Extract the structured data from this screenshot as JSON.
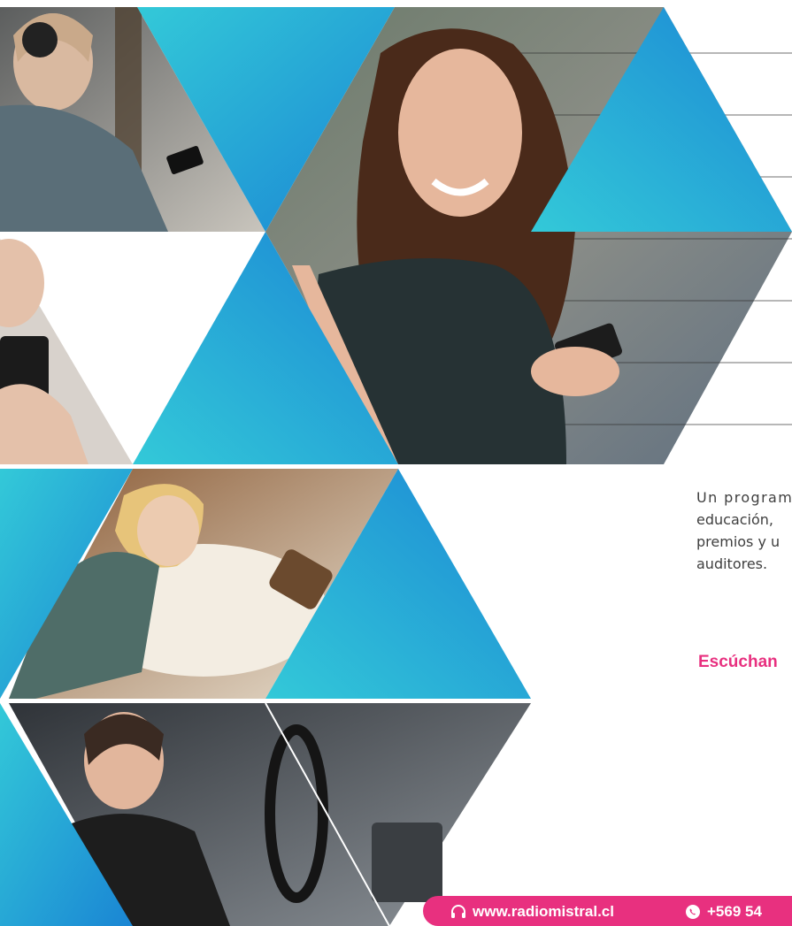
{
  "intro": {
    "line1": "Un program",
    "line2": "educación, ",
    "line3": "premios y u",
    "line4": "auditores."
  },
  "cta": {
    "label": "Escúchan"
  },
  "footer": {
    "website": "www.radiomistral.cl",
    "phone": "+569 54",
    "web_icon": "headphones-icon",
    "phone_icon": "whatsapp-icon"
  },
  "colors": {
    "accent": "#e8307f",
    "triangle_light": "#2ec4d6",
    "triangle_dark": "#1e88d6"
  }
}
